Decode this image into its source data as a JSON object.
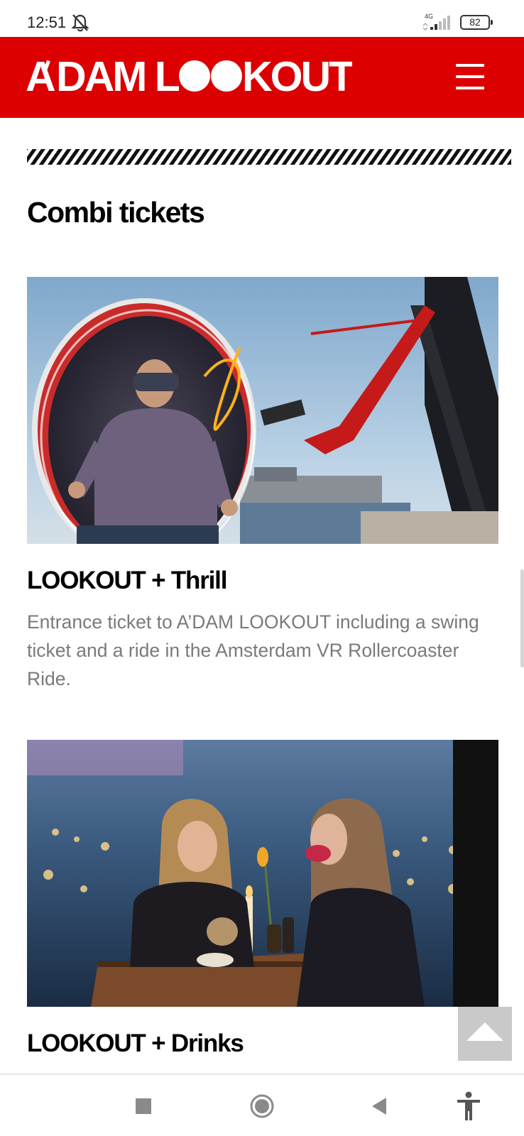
{
  "status_bar": {
    "time": "12:51",
    "network": "4G",
    "battery": "82"
  },
  "header": {
    "logo_text": "A'DAM LOOKOUT",
    "brand_color": "#dc0000",
    "menu_icon": "hamburger-icon"
  },
  "main": {
    "section_title": "Combi tickets",
    "cards": [
      {
        "title": "LOOKOUT + Thrill",
        "description": "Entrance ticket to A’DAM LOOKOUT including a swing ticket and a ride in the Amsterdam VR Rollercoaster Ride."
      },
      {
        "title": "LOOKOUT + Drinks"
      }
    ]
  },
  "nav_bar": {
    "icons": [
      "recents-icon",
      "home-icon",
      "back-icon",
      "accessibility-icon"
    ]
  }
}
